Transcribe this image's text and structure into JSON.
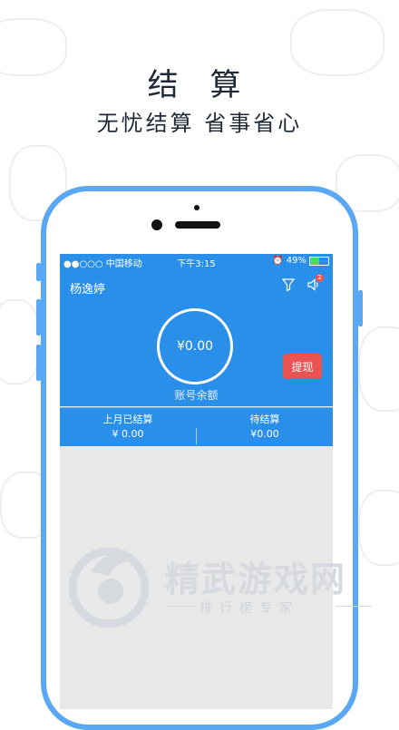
{
  "headline": "结 算",
  "subheadline": "无忧结算 省事省心",
  "status_bar": {
    "carrier": "●●○○○ 中国移动",
    "time": "下午3:15",
    "battery_percent": "49%",
    "battery_level": 0.49
  },
  "header": {
    "user_name": "杨逸婷",
    "notification_count": "2"
  },
  "balance": {
    "amount": "¥0.00",
    "label": "账号余额"
  },
  "withdraw_button": "提现",
  "stats": {
    "last_month_label": "上月已结算",
    "last_month_value": "¥ 0.00",
    "pending_label": "待结算",
    "pending_value": "¥0.00"
  },
  "watermark": {
    "title": "精武游戏网",
    "subtitle": "排行榜专家"
  },
  "colors": {
    "brand_blue": "#2a8fe8",
    "phone_frame": "#5aa8f4",
    "withdraw_red": "#e95352",
    "content_gray": "#e8e8e8"
  }
}
